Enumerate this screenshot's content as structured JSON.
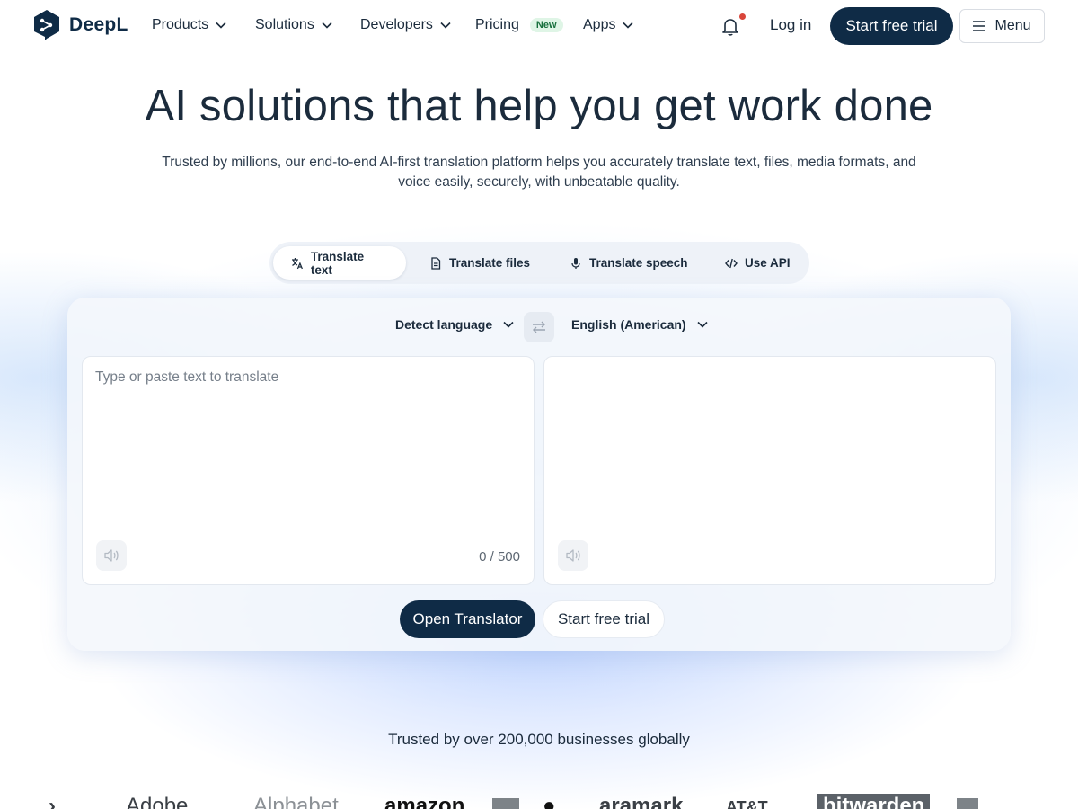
{
  "nav": {
    "logo_text": "DeepL",
    "items": [
      {
        "label": "Products"
      },
      {
        "label": "Solutions"
      },
      {
        "label": "Developers"
      },
      {
        "label": "Pricing",
        "badge": "New"
      },
      {
        "label": "Apps"
      }
    ],
    "login_label": "Log in",
    "trial_label": "Start free trial",
    "menu_label": "Menu",
    "notification_dot_color": "#d9453a"
  },
  "hero": {
    "title": "AI solutions that help you get work done",
    "subtitle_line1": "Trusted by millions, our end-to-end AI-first translation platform helps you accurately translate text, files, media formats, and",
    "subtitle_line2": "voice easily, securely, with unbeatable quality."
  },
  "tabs": [
    {
      "label": "Translate text",
      "icon": "translate-icon",
      "active": true
    },
    {
      "label": "Translate files",
      "icon": "file-icon",
      "active": false
    },
    {
      "label": "Translate speech",
      "icon": "microphone-icon",
      "active": false
    },
    {
      "label": "Use API",
      "icon": "code-icon",
      "active": false
    }
  ],
  "translator": {
    "source_language": "Detect language",
    "target_language": "English (American)",
    "source_placeholder": "Type or paste text to translate",
    "char_count": "0 / 500",
    "open_label": "Open Translator",
    "trial_label": "Start free trial"
  },
  "trusted": {
    "text": "Trusted by over 200,000 businesses globally",
    "brands": [
      "Adobe",
      "Alphabet",
      "amazon",
      "aramark",
      "AT&T",
      "bitwarden"
    ]
  },
  "colors": {
    "primary": "#0f2b46",
    "accent_new_bg": "#dff5e6"
  }
}
